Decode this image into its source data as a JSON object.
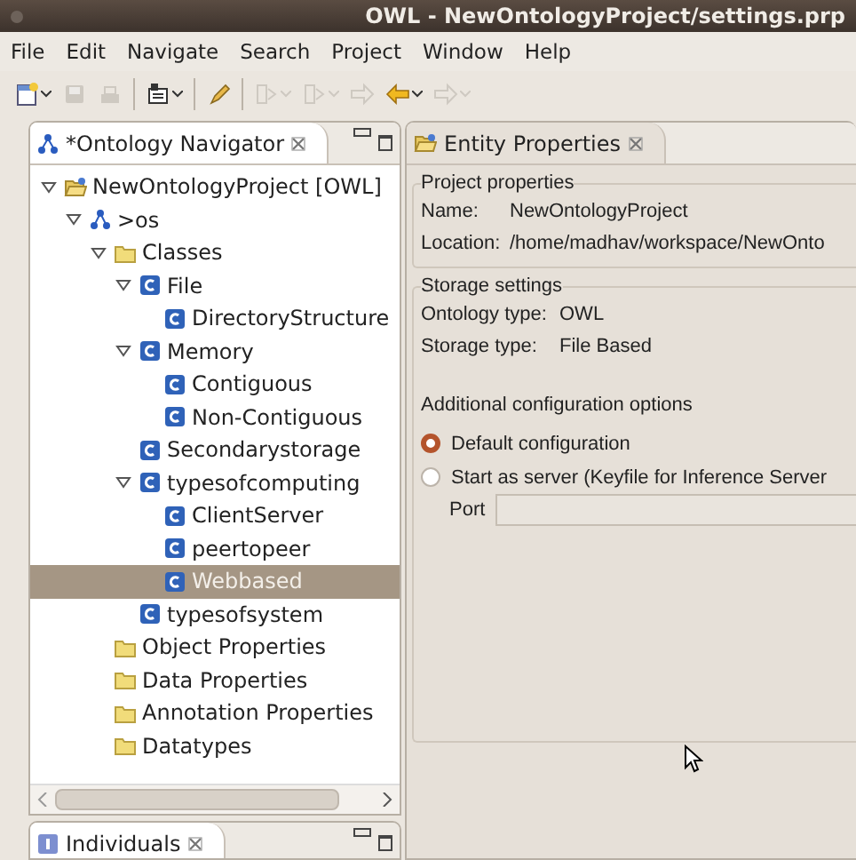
{
  "window": {
    "title": "OWL - NewOntologyProject/settings.prp"
  },
  "menu": [
    "File",
    "Edit",
    "Navigate",
    "Search",
    "Project",
    "Window",
    "Help"
  ],
  "toolbar": [
    {
      "kind": "new",
      "disabled": false,
      "dropdown": true
    },
    {
      "kind": "save",
      "disabled": true,
      "dropdown": false
    },
    {
      "kind": "print",
      "disabled": true,
      "dropdown": false
    },
    {
      "kind": "sep"
    },
    {
      "kind": "open-type",
      "disabled": false,
      "dropdown": true
    },
    {
      "kind": "sep"
    },
    {
      "kind": "pen",
      "disabled": false,
      "dropdown": false
    },
    {
      "kind": "sep"
    },
    {
      "kind": "next-annotation",
      "disabled": true,
      "dropdown": true
    },
    {
      "kind": "prev-annotation",
      "disabled": true,
      "dropdown": true
    },
    {
      "kind": "last-edit",
      "disabled": true,
      "dropdown": false
    },
    {
      "kind": "back",
      "disabled": false,
      "dropdown": true
    },
    {
      "kind": "forward",
      "disabled": true,
      "dropdown": true
    }
  ],
  "navigator": {
    "title": "*Ontology Navigator",
    "tree": [
      {
        "label": "NewOntologyProject [OWL]",
        "kind": "project",
        "expanded": true,
        "selected": false,
        "children": [
          {
            "label": ">os",
            "kind": "ontology",
            "expanded": true,
            "selected": false,
            "children": [
              {
                "label": "Classes",
                "kind": "folder",
                "expanded": true,
                "selected": false,
                "children": [
                  {
                    "label": "File",
                    "kind": "class",
                    "expanded": true,
                    "selected": false,
                    "children": [
                      {
                        "label": "DirectoryStructure",
                        "kind": "class",
                        "selected": false
                      }
                    ]
                  },
                  {
                    "label": "Memory",
                    "kind": "class",
                    "expanded": true,
                    "selected": false,
                    "children": [
                      {
                        "label": "Contiguous",
                        "kind": "class",
                        "selected": false
                      },
                      {
                        "label": "Non-Contiguous",
                        "kind": "class",
                        "selected": false
                      }
                    ]
                  },
                  {
                    "label": "Secondarystorage",
                    "kind": "class",
                    "selected": false
                  },
                  {
                    "label": "typesofcomputing",
                    "kind": "class",
                    "expanded": true,
                    "selected": false,
                    "children": [
                      {
                        "label": "ClientServer",
                        "kind": "class",
                        "selected": false
                      },
                      {
                        "label": "peertopeer",
                        "kind": "class",
                        "selected": false
                      },
                      {
                        "label": "Webbased",
                        "kind": "class",
                        "selected": true
                      }
                    ]
                  },
                  {
                    "label": "typesofsystem",
                    "kind": "class",
                    "selected": false
                  }
                ]
              },
              {
                "label": "Object Properties",
                "kind": "folder",
                "selected": false
              },
              {
                "label": "Data Properties",
                "kind": "folder",
                "selected": false
              },
              {
                "label": "Annotation Properties",
                "kind": "folder",
                "selected": false
              },
              {
                "label": "Datatypes",
                "kind": "folder",
                "selected": false
              }
            ]
          }
        ]
      }
    ]
  },
  "individuals": {
    "title": "Individuals"
  },
  "editor": {
    "title": "Entity Properties",
    "project_properties": {
      "title": "Project properties",
      "rows": [
        {
          "label": "Name:",
          "value": "NewOntologyProject"
        },
        {
          "label": "Location:",
          "value": "/home/madhav/workspace/NewOnto"
        }
      ]
    },
    "storage_settings": {
      "title": "Storage settings",
      "rows": [
        {
          "label": "Ontology type:",
          "value": "OWL"
        },
        {
          "label": "Storage type:",
          "value": "File Based"
        }
      ],
      "options_title": "Additional configuration options",
      "options": [
        {
          "label": "Default configuration",
          "selected": true
        },
        {
          "label": "Start as server (Keyfile for Inference Server",
          "selected": false
        }
      ],
      "port": {
        "label": "Port"
      }
    }
  }
}
